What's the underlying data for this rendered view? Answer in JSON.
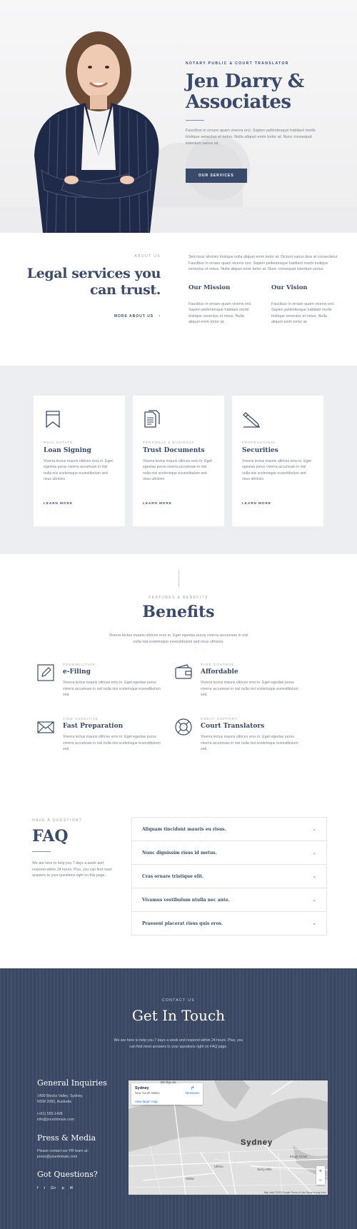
{
  "hero": {
    "eyebrow": "NOTARY PUBLIC & COURT TRANSLATOR",
    "title_line1": "Jen Darry &",
    "title_line2": "Associates",
    "description": "Faucibus in ornare quam viverra orci. Sapien pellentesque habitant morbi tristique senectus et netus. Nulla aliquet enim tortor at. Nunc consequat interdum varius sit.",
    "button": "OUR SERVICES"
  },
  "about": {
    "eyebrow": "ABOUT US",
    "title_line1": "Legal services you",
    "title_line2": "can trust.",
    "link": "MORE ABOUT US",
    "intro": "Sed risus ultricies tristique nulla aliquet enim tortor at. Dictum varius duis at consectetur. Faucibus in ornare quam viverra orci. Sapien pellentesque habitant morbi tristique senectus et netus. Nulla aliquet enim tortor at. Nunc consequat interdum varius.",
    "mission_title": "Our Mission",
    "mission_text": "Faucibus in ornare quam viverra orci. Sapien pellentesque habitant morbi tristique senectus et netus. Nulla aliquet enim tortor at.",
    "vision_title": "Our Vision",
    "vision_text": "Faucibus in ornare quam viverra orci. Sapien pellentesque habitant morbi tristique senectus et netus. Nulla aliquet enim tortor at."
  },
  "services": [
    {
      "eyebrow": "REAL ESTATE",
      "title": "Loan Signing",
      "desc": "Viverra lectus mauris ultrices eros in. Eget egestas purus viverra accumsan in nisl nulla nisi scelerisque euvestibulum sed risus ultricies.",
      "link": "LEARN MORE",
      "icon": "bookmark-icon"
    },
    {
      "eyebrow": "PERSONAL & BUSINESS",
      "title": "Trust Documents",
      "desc": "Viverra lectus mauris ultrices eros in. Eget egestas purus viverra accumsan in nisl nulla nisi scelerisque euvestibulum sed risus ultricies.",
      "link": "LEARN MORE",
      "icon": "documents-icon"
    },
    {
      "eyebrow": "PROFESSIONAL",
      "title": "Securities",
      "desc": "Viverra lectus mauris ultrices eros in. Eget egestas purus viverra accumsan in nisl nulla nisi scelerisque euvestibulum sed risus ultricies.",
      "link": "LEARN MORE",
      "icon": "pen-icon"
    }
  ],
  "benefits": {
    "eyebrow": "FEATURES & BENEFITS",
    "title": "Benefits",
    "intro": "Viverra lectus mauris ultrices eros in. Eget egestas purus viverra accumsan in nisl nulla nisi scelerisque euvestibulum sed risus ultricies.",
    "items": [
      {
        "eyebrow": "POSSIBILITIES",
        "title": "e-Filing",
        "desc": "Viverra lectus mauris ultrices eros in. Eget egestas purus viverra accumsan in nisl nulla nisi scelerisque euvestibulum sed.",
        "icon": "edit-icon"
      },
      {
        "eyebrow": "TAKE CONTROL",
        "title": "Affordable",
        "desc": "Viverra lectus mauris ultrices eros in. Eget egestas purus viverra accumsan in nisl nulla nisi scelerisque euvestibulum sed.",
        "icon": "wallet-icon"
      },
      {
        "eyebrow": "TIME SENSITIVE",
        "title": "Fast Preparation",
        "desc": "Viverra lectus mauris ultrices eros in. Eget egestas purus viverra accumsan in nisl nulla nisi scelerisque euvestibulum sed.",
        "icon": "envelope-icon"
      },
      {
        "eyebrow": "GREAT SUPPORT",
        "title": "Court Translators",
        "desc": "Viverra lectus mauris ultrices eros in. Eget egestas purus viverra accumsan in nisl nulla nisi scelerisque euvestibulum sed.",
        "icon": "lifebuoy-icon"
      }
    ]
  },
  "faq": {
    "eyebrow": "HAVE A QUESTION?",
    "title": "FAQ",
    "desc": "We are here to help you 7 days a week and respond within 24 hours. Plus, you can find most answers to your questions right on this page.",
    "questions": [
      "Aliquam tincidunt mauris eu risus.",
      "Nunc dignissim risus id metus.",
      "Cras ornare tristique elit.",
      "Vivamus vestibulum ntulla nec ante.",
      "Praesent placerat risus quis eros."
    ]
  },
  "contact": {
    "eyebrow": "CONTACT US",
    "title": "Get In Touch",
    "desc": "We are here to help you 7 days a week and respond within 24 hours. Plus, you can find most answers to your questions right on FAQ page.",
    "general_title": "General Inquiries",
    "address_line1": "1400 Blocks Valley, Sydney,",
    "address_line2": "NSW 2060, Australia",
    "phone": "(+61) 555-1408",
    "email": "info@yourdomain.com",
    "press_title": "Press & Media",
    "press_line1": "Please contact our PR team at:",
    "press_line2": "press@yourdomain.com",
    "questions_title": "Got Questions?",
    "social": [
      "f",
      "t",
      "G+",
      "p",
      "m"
    ]
  },
  "map": {
    "place": "Sydney",
    "region": "New South Wales",
    "larger_map": "View larger map",
    "directions": "Directions",
    "city_label": "Sydney",
    "footer": "Map data ©2019 Google   Terms of Use   Report a map error",
    "labels": [
      "Birchgrove",
      "Kings Cross",
      "Glebe",
      "Surry Hills",
      "Ultimo"
    ]
  }
}
